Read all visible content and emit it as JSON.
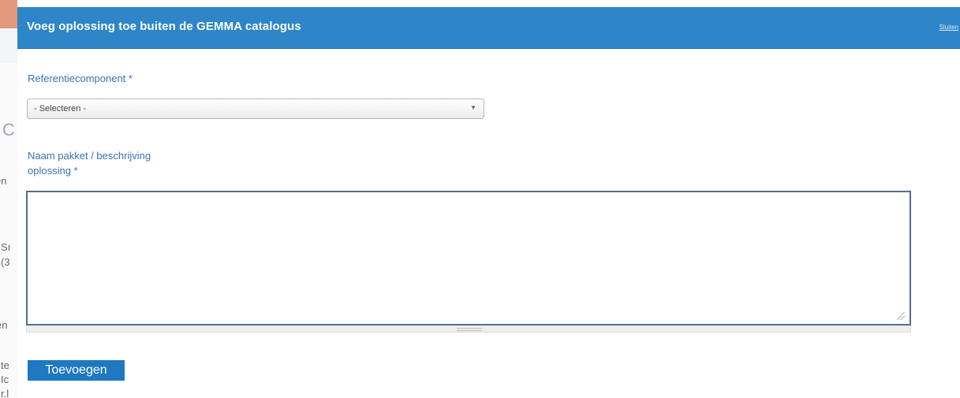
{
  "dialog": {
    "title": "Voeg oplossing toe buiten de GEMMA catalogus",
    "close_label": "Sluiten"
  },
  "form": {
    "reference_label": "Referentiecomponent *",
    "reference_select": {
      "selected": "- Selecteren -",
      "arrow_icon": "triangle-down"
    },
    "name_label_line1": "Naam pakket / beschrijving",
    "name_label_line2": "oplossing *",
    "name_textarea_value": "",
    "submit_label": "Toevoegen"
  },
  "background_page": {
    "fragments": [
      "C",
      "en",
      "Sı",
      "(3",
      "en",
      "te",
      "Ic",
      "r.l"
    ]
  },
  "colors": {
    "header": "#2e86c8",
    "label": "#3a73b2",
    "button": "#1e78c2"
  }
}
